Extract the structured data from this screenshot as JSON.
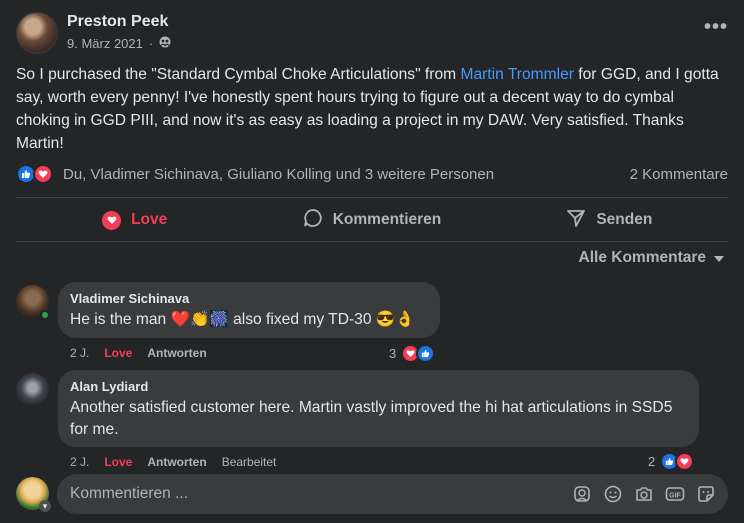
{
  "post": {
    "author": "Preston Peek",
    "date": "9. März 2021",
    "privacy_icon": "people-icon",
    "text_before_link": "So I purchased the \"Standard Cymbal Choke Articulations\" from ",
    "link_text": "Martin Trommler",
    "text_after_link": " for GGD, and I gotta say, worth every penny! I've honestly spent hours trying to figure out a decent way to do cymbal choking in GGD PIII, and now it's as easy as loading a project in my DAW. Very satisfied. Thanks Martin!",
    "reactions_names": "Du, Vladimer Sichinava, Giuliano Kolling und 3 weitere Personen",
    "comment_count": "2 Kommentare"
  },
  "actions": {
    "love": "Love",
    "comment": "Kommentieren",
    "share": "Senden"
  },
  "sort_label": "Alle Kommentare",
  "comments": [
    {
      "name": "Vladimer Sichinava",
      "text": "He is the man ❤️👏🎆 also fixed my TD-30 😎👌",
      "time": "2 J.",
      "love": "Love",
      "reply": "Antworten",
      "reaction_count": "3"
    },
    {
      "name": "Alan Lydiard",
      "text": "Another satisfied customer here. Martin vastly improved the hi hat articulations in SSD5 for me.",
      "time": "2 J.",
      "love": "Love",
      "reply": "Antworten",
      "edited": "Bearbeitet",
      "reaction_count": "2"
    }
  ],
  "composer": {
    "placeholder": "Kommentieren ..."
  },
  "colors": {
    "background": "#242526",
    "bubble": "#3a3b3c",
    "link": "#4599ff",
    "love": "#f33e58",
    "like": "#1b74e4"
  }
}
